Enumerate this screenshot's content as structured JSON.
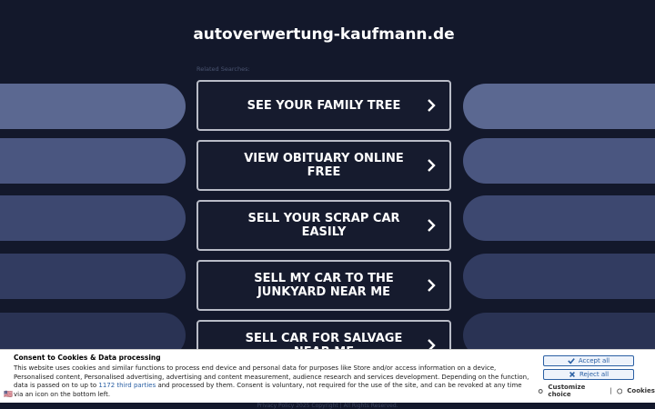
{
  "site_title": "autoverwertung-kaufmann.de",
  "related_label": "Related Searches:",
  "links": [
    {
      "label": "SEE YOUR FAMILY TREE"
    },
    {
      "label": "VIEW OBITUARY ONLINE FREE"
    },
    {
      "label": "SELL YOUR SCRAP CAR EASILY"
    },
    {
      "label": "SELL MY CAR TO THE JUNKYARD NEAR ME"
    },
    {
      "label": "SELL CAR FOR SALVAGE NEAR ME"
    }
  ],
  "footer": {
    "privacy": "Privacy Policy",
    "copyright": "2025 Copyright | All Rights Reserved."
  },
  "consent": {
    "title": "Consent to Cookies & Data processing",
    "text_before": "This website uses cookies and similar functions to process end device and personal data for purposes like Store and/or access information on a device, Personalised content, Personalised advertising, advertising and content measurement, audience research and services development. Depending on the function, data is passed on to up to ",
    "third_parties": "1172 third parties",
    "text_after": " and processed by them. Consent is voluntary, not required for the use of the site, and can be revoked at any time via an icon on the bottom left.",
    "accept_label": "Accept all",
    "reject_label": "Reject all",
    "customize_label": "Customize choice",
    "cookies_label": "Cookies",
    "separator": "|"
  },
  "colors": {
    "background": "#13182b",
    "pill_light": "#5d6a93",
    "accent_blue": "#2a5fa3"
  },
  "icons": [
    "chevron-right-icon",
    "check-icon",
    "x-icon",
    "settings-icon",
    "cookie-icon",
    "flag-icon"
  ]
}
